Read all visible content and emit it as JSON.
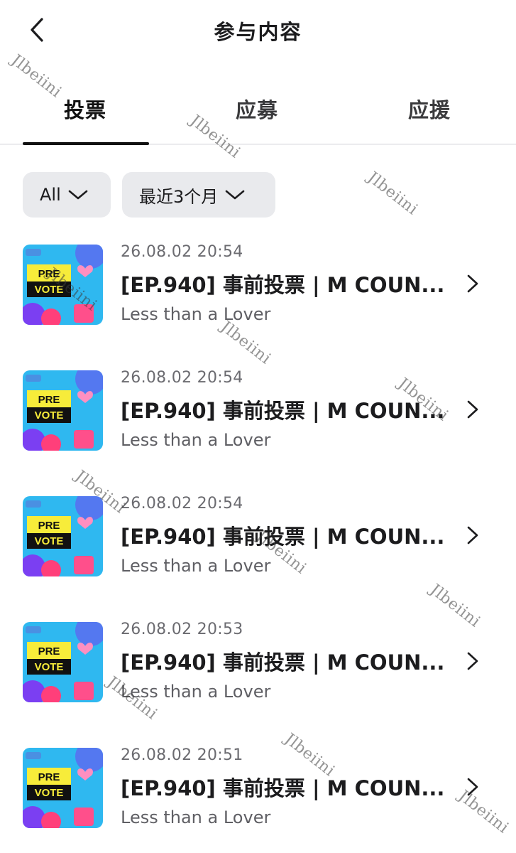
{
  "header": {
    "title": "参与内容",
    "back_icon": "chevron-left-icon"
  },
  "tabs": [
    {
      "label": "投票",
      "active": true
    },
    {
      "label": "应募",
      "active": false
    },
    {
      "label": "应援",
      "active": false
    }
  ],
  "filters": {
    "type": {
      "label": "All",
      "icon": "chevron-down-icon"
    },
    "period": {
      "label": "最近3个月",
      "icon": "chevron-down-icon"
    }
  },
  "items": [
    {
      "date": "26.08.02 20:54",
      "title": "[EP.940] 事前投票 | M COUN...",
      "subtitle": "Less than a Lover",
      "thumb_text": [
        "PRE",
        "VOTE"
      ]
    },
    {
      "date": "26.08.02 20:54",
      "title": "[EP.940] 事前投票 | M COUN...",
      "subtitle": "Less than a Lover",
      "thumb_text": [
        "PRE",
        "VOTE"
      ]
    },
    {
      "date": "26.08.02 20:54",
      "title": "[EP.940] 事前投票 | M COUN...",
      "subtitle": "Less than a Lover",
      "thumb_text": [
        "PRE",
        "VOTE"
      ]
    },
    {
      "date": "26.08.02 20:53",
      "title": "[EP.940] 事前投票 | M COUN...",
      "subtitle": "Less than a Lover",
      "thumb_text": [
        "PRE",
        "VOTE"
      ]
    },
    {
      "date": "26.08.02 20:51",
      "title": "[EP.940] 事前投票 | M COUN...",
      "subtitle": "Less than a Lover",
      "thumb_text": [
        "PRE",
        "VOTE"
      ]
    }
  ],
  "watermark": "Jlbeiini",
  "colors": {
    "accent": "#111111",
    "filter_bg": "#e9eaed",
    "thumb_bg": "#2fb8f0",
    "thumb_banner": "#f7ec3a"
  }
}
